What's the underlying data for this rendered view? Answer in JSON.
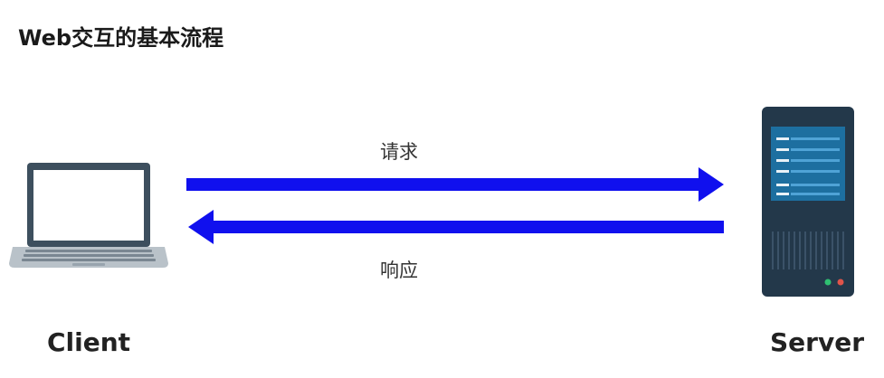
{
  "title": "Web交互的基本流程",
  "client": {
    "label": "Client",
    "icon": "laptop-icon"
  },
  "server": {
    "label": "Server",
    "icon": "server-icon"
  },
  "request": {
    "label": "请求",
    "direction": "client-to-server"
  },
  "response": {
    "label": "响应",
    "direction": "server-to-client"
  },
  "colors": {
    "arrow": "#1010ee",
    "laptop_frame": "#3d4f5e",
    "laptop_screen": "#ffffff",
    "laptop_base": "#b9c2c9",
    "server_body": "#23384a",
    "server_panel": "#1d6fa0",
    "led_green": "#2fbf71",
    "led_red": "#e0544a"
  }
}
